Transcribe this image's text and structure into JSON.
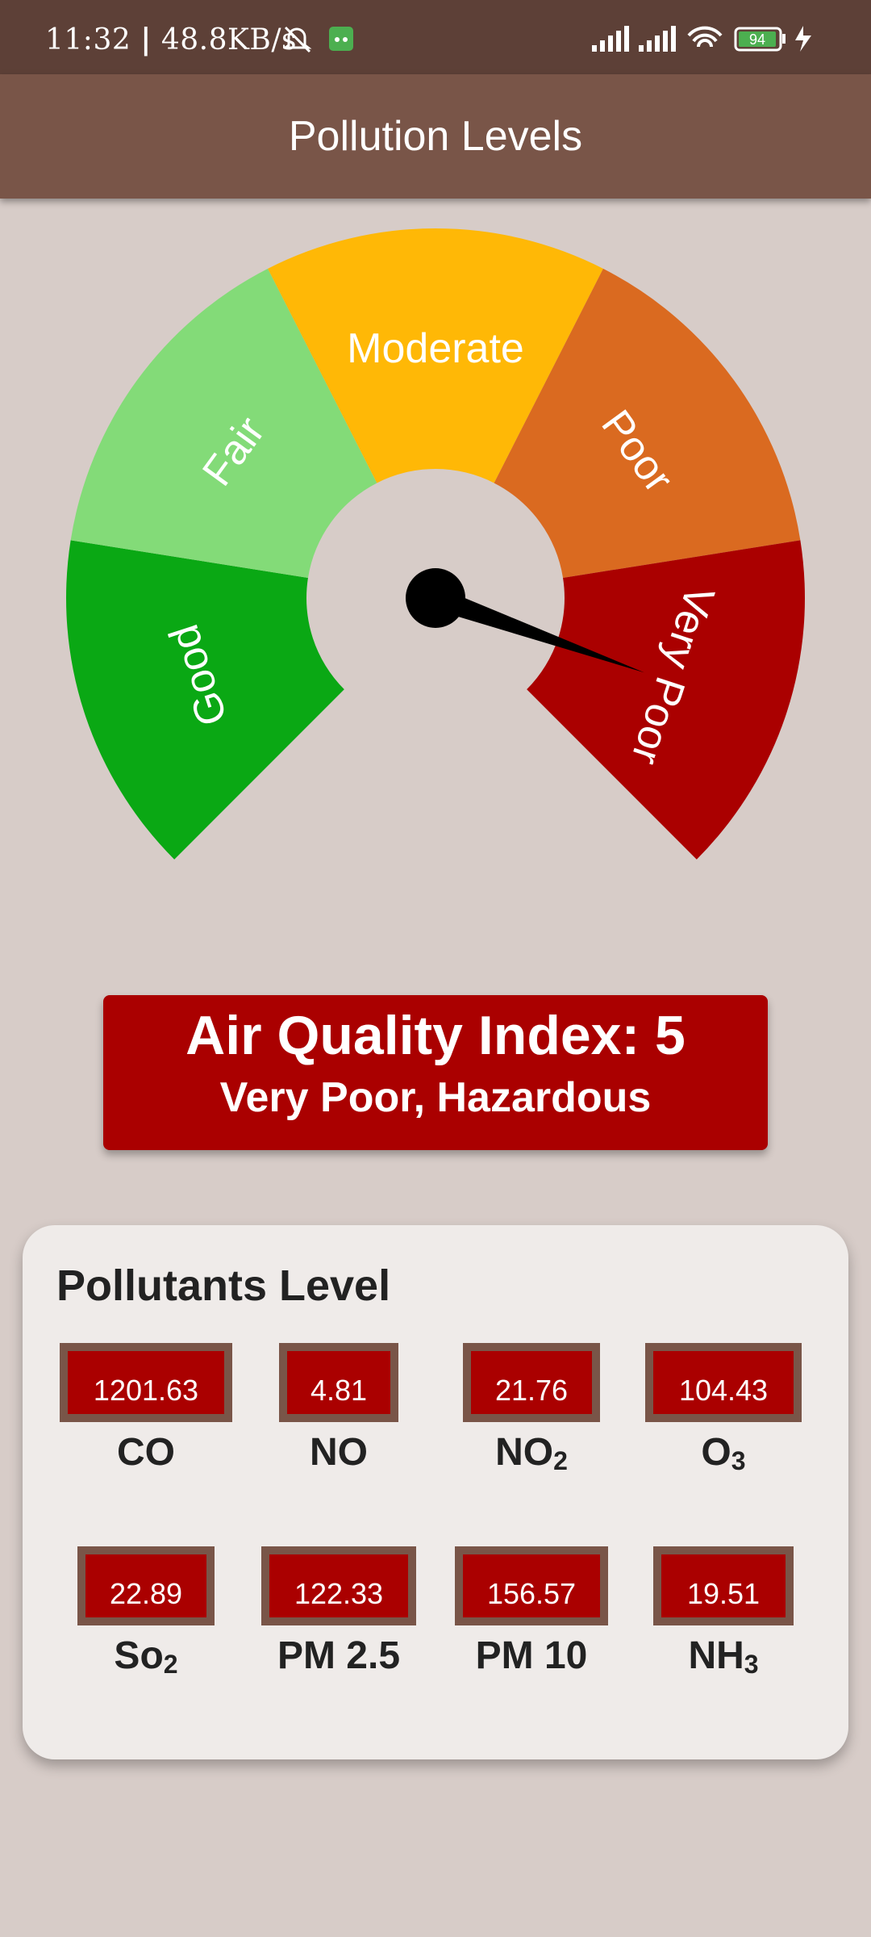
{
  "status_bar": {
    "time": "11:32",
    "speed": "48.8KB/s",
    "battery": "94",
    "icons": [
      "mute-icon",
      "android-app-icon",
      "signal-icon",
      "wifi-icon",
      "battery-icon",
      "charging-icon"
    ]
  },
  "app_bar": {
    "title": "Pollution Levels"
  },
  "gauge": {
    "segments": [
      {
        "label": "Good",
        "color": "#0aa814"
      },
      {
        "label": "Fair",
        "color": "#83db78"
      },
      {
        "label": "Moderate",
        "color": "#ffb806"
      },
      {
        "label": "Poor",
        "color": "#da6a20"
      },
      {
        "label": "Very Poor",
        "color": "#aa0000"
      }
    ],
    "needle_value": 5
  },
  "aqi": {
    "title": "Air Quality Index: 5",
    "description": "Very Poor, Hazardous"
  },
  "pollutants": {
    "title": "Pollutants Level",
    "items": [
      {
        "value": "1201.63",
        "label": "CO",
        "sub": ""
      },
      {
        "value": "4.81",
        "label": "NO",
        "sub": ""
      },
      {
        "value": "21.76",
        "label": "NO",
        "sub": "2"
      },
      {
        "value": "104.43",
        "label": "O",
        "sub": "3"
      },
      {
        "value": "22.89",
        "label": "So",
        "sub": "2"
      },
      {
        "value": "122.33",
        "label": "PM 2.5",
        "sub": ""
      },
      {
        "value": "156.57",
        "label": "PM 10",
        "sub": ""
      },
      {
        "value": "19.51",
        "label": "NH",
        "sub": "3"
      }
    ]
  }
}
